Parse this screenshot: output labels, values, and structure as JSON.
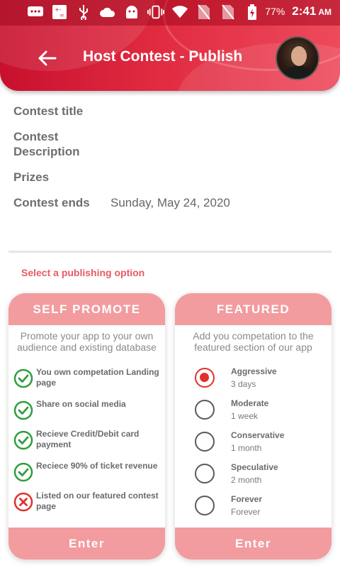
{
  "status_bar": {
    "battery": "77%",
    "time": "2:41",
    "ampm": "AM",
    "icons": [
      "message-icon",
      "calculator-icon",
      "usb-icon",
      "cloud-icon",
      "android-icon",
      "vibrate-icon",
      "wifi-icon",
      "no-sim-icon",
      "no-sim-icon",
      "battery-charging-icon"
    ]
  },
  "header": {
    "title": "Host Contest - Publish",
    "back_icon": "arrow-left-icon",
    "avatar": "profile-avatar"
  },
  "details": [
    {
      "label": "Contest title",
      "value": ""
    },
    {
      "label": "Contest Description",
      "value": ""
    },
    {
      "label": "Prizes",
      "value": ""
    },
    {
      "label": "Contest ends",
      "value": "Sunday, May 24, 2020"
    }
  ],
  "publishing": {
    "prompt": "Select a publishing option",
    "self_promote": {
      "title": "SELF PROMOTE",
      "description": "Promote your app to your own audience and existing database",
      "features": [
        {
          "text": "You own competation Landing page",
          "included": true
        },
        {
          "text": "Share on social media",
          "included": true
        },
        {
          "text": "Recieve Credit/Debit card payment",
          "included": true
        },
        {
          "text": "Reciece 90% of ticket revenue",
          "included": true
        },
        {
          "text": "Listed on our featured contest page",
          "included": false
        }
      ],
      "button": "Enter"
    },
    "featured": {
      "title": "FEATURED",
      "description": "Add you competation to the featured section of our app",
      "options": [
        {
          "name": "Aggressive",
          "duration": "3 days",
          "selected": true
        },
        {
          "name": "Moderate",
          "duration": "1 week",
          "selected": false
        },
        {
          "name": "Conservative",
          "duration": "1 month",
          "selected": false
        },
        {
          "name": "Speculative",
          "duration": "2 month",
          "selected": false
        },
        {
          "name": "Forever",
          "duration": "Forever",
          "selected": false
        }
      ],
      "button": "Enter"
    }
  },
  "colors": {
    "header_red": "#c8102e",
    "accent_pink": "#f29c9f",
    "check_green": "#2e9e3e",
    "cross_red": "#e0312f",
    "prompt_red": "#e85a64"
  }
}
